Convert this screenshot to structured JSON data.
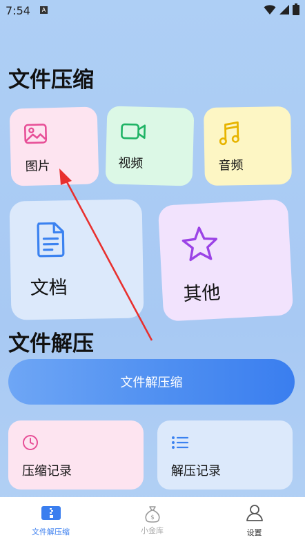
{
  "status_bar": {
    "time": "7:54",
    "notification_letter": "A"
  },
  "compress": {
    "title": "文件压缩",
    "cards": {
      "image": {
        "label": "图片",
        "icon": "image-icon"
      },
      "video": {
        "label": "视频",
        "icon": "video-icon"
      },
      "audio": {
        "label": "音频",
        "icon": "music-note-icon"
      },
      "document": {
        "label": "文档",
        "icon": "document-icon"
      },
      "other": {
        "label": "其他",
        "icon": "star-icon"
      }
    }
  },
  "extract": {
    "title": "文件解压",
    "button_label": "文件解压缩",
    "records": {
      "compress": {
        "label": "压缩记录",
        "icon": "clock-icon"
      },
      "extract": {
        "label": "解压记录",
        "icon": "list-icon"
      }
    }
  },
  "tab_bar": {
    "tabs": [
      {
        "label": "文件解压缩",
        "icon": "zip-file-icon",
        "active": true
      },
      {
        "label": "小金库",
        "icon": "money-bag-icon",
        "active": false
      },
      {
        "label": "设置",
        "icon": "person-icon",
        "active": false
      }
    ]
  },
  "colors": {
    "background": "#aecff5",
    "image_card": "#fde4f0",
    "video_card": "#dcf8e6",
    "audio_card": "#fdf6c4",
    "document_card": "#dce9fb",
    "other_card": "#f2e3fd",
    "accent_blue": "#3a7eef",
    "arrow_red": "#e8302e"
  }
}
